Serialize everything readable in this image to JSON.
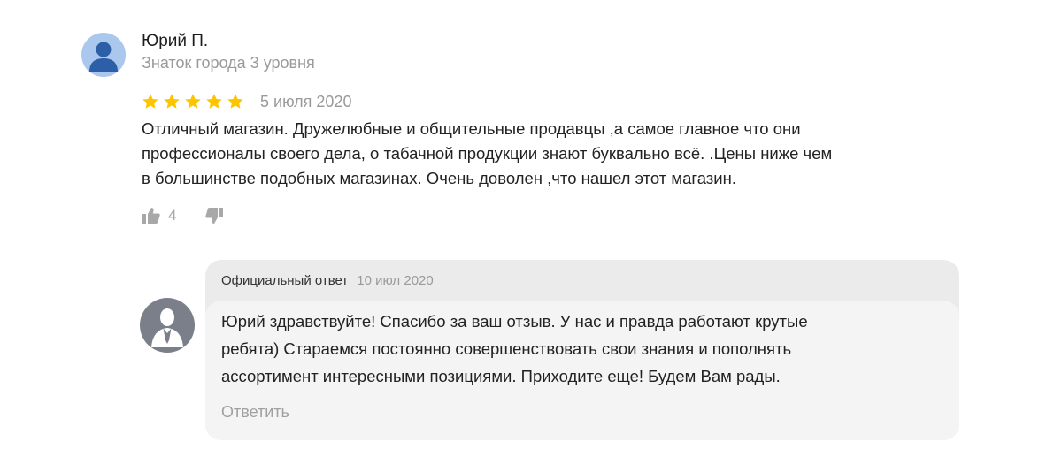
{
  "review": {
    "author_name": "Юрий П.",
    "author_level": "Знаток города 3 уровня",
    "rating": 5,
    "rating_max": 5,
    "date": "5 июля 2020",
    "text_lines": [
      "Отличный магазин. Дружелюбные и общительные продавцы ,а самое главное что они",
      "профессионалы своего дела, о табачной продукции знают буквально всё. .Цены ниже чем",
      "в большинстве подобных магазинах. Очень доволен ,что нашел этот магазин."
    ],
    "likes": "4",
    "icons": {
      "avatar": "user-avatar-icon",
      "star": "star-icon",
      "like": "thumbs-up-icon",
      "dislike": "thumbs-down-icon"
    }
  },
  "official_answer": {
    "label": "Официальный ответ",
    "date": "10 июл 2020",
    "text_lines": [
      "Юрий здравствуйте! Спасибо за ваш отзыв. У нас и правда работают крутые",
      "ребята) Стараемся постоянно совершенствовать свои знания и пополнять",
      "ассортимент интересными позициями. Приходите еще! Будем Вам рады."
    ],
    "reply_label": "Ответить"
  },
  "colors": {
    "star": "#fcc500",
    "muted_text": "#9a9a9a",
    "avatar_bg": "#aac7ee",
    "answer_card_bg": "#ebebeb",
    "answer_body_bg": "#f4f4f4"
  }
}
